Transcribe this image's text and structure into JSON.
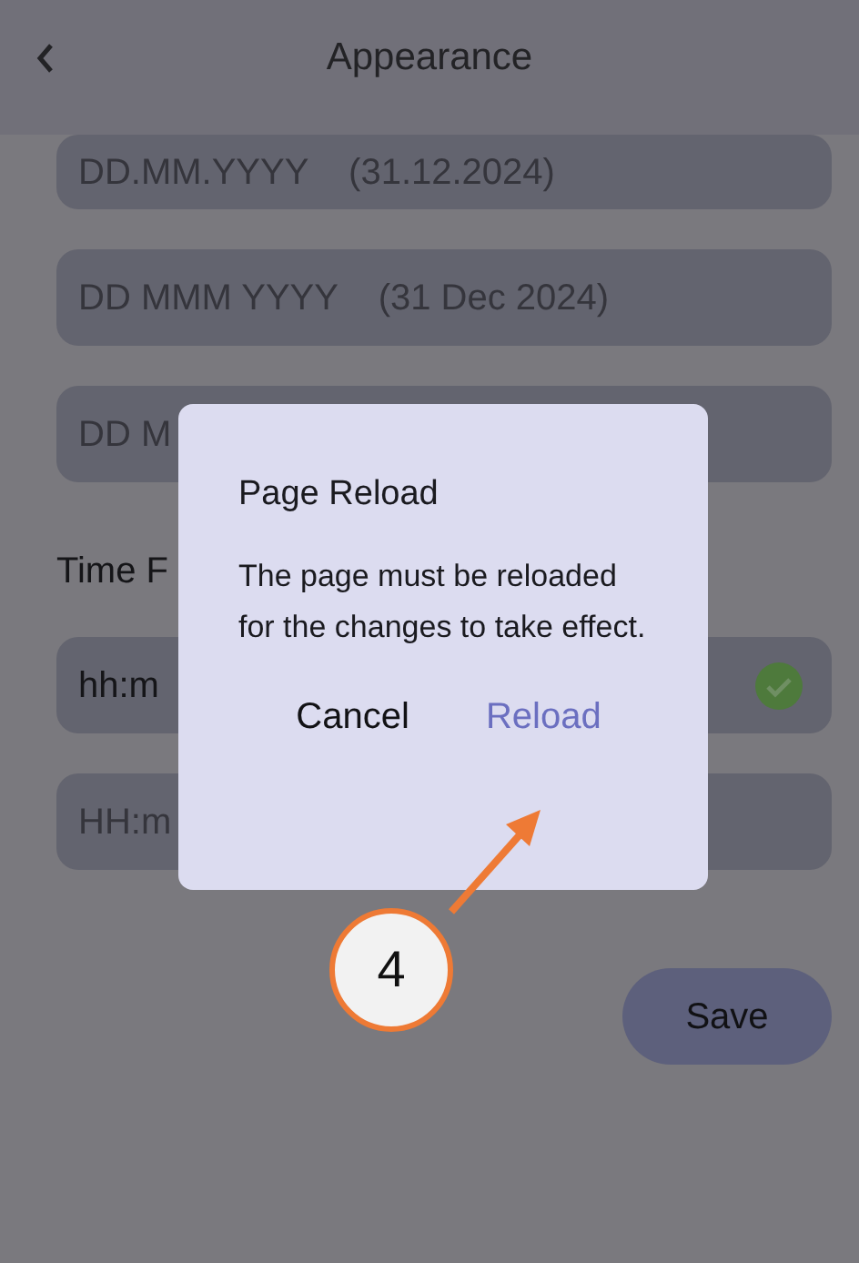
{
  "header": {
    "title": "Appearance"
  },
  "date_options": [
    {
      "label": "DD.MM.YYYY    (31.12.2024)",
      "selected": false
    },
    {
      "label": "DD MMM YYYY    (31 Dec 2024)",
      "selected": false
    },
    {
      "label": "DD M",
      "selected": false
    }
  ],
  "time_section": {
    "label": "Time F"
  },
  "time_options": [
    {
      "label": "hh:m",
      "selected": true
    },
    {
      "label": "HH:m",
      "selected": false
    }
  ],
  "save_button": "Save",
  "dialog": {
    "title": "Page Reload",
    "message": "The page must be reloaded for the changes to take effect.",
    "buttons": [
      {
        "label": "Cancel",
        "kind": "secondary"
      },
      {
        "label": "Reload",
        "kind": "primary"
      }
    ]
  },
  "annotation": {
    "number": "4"
  }
}
